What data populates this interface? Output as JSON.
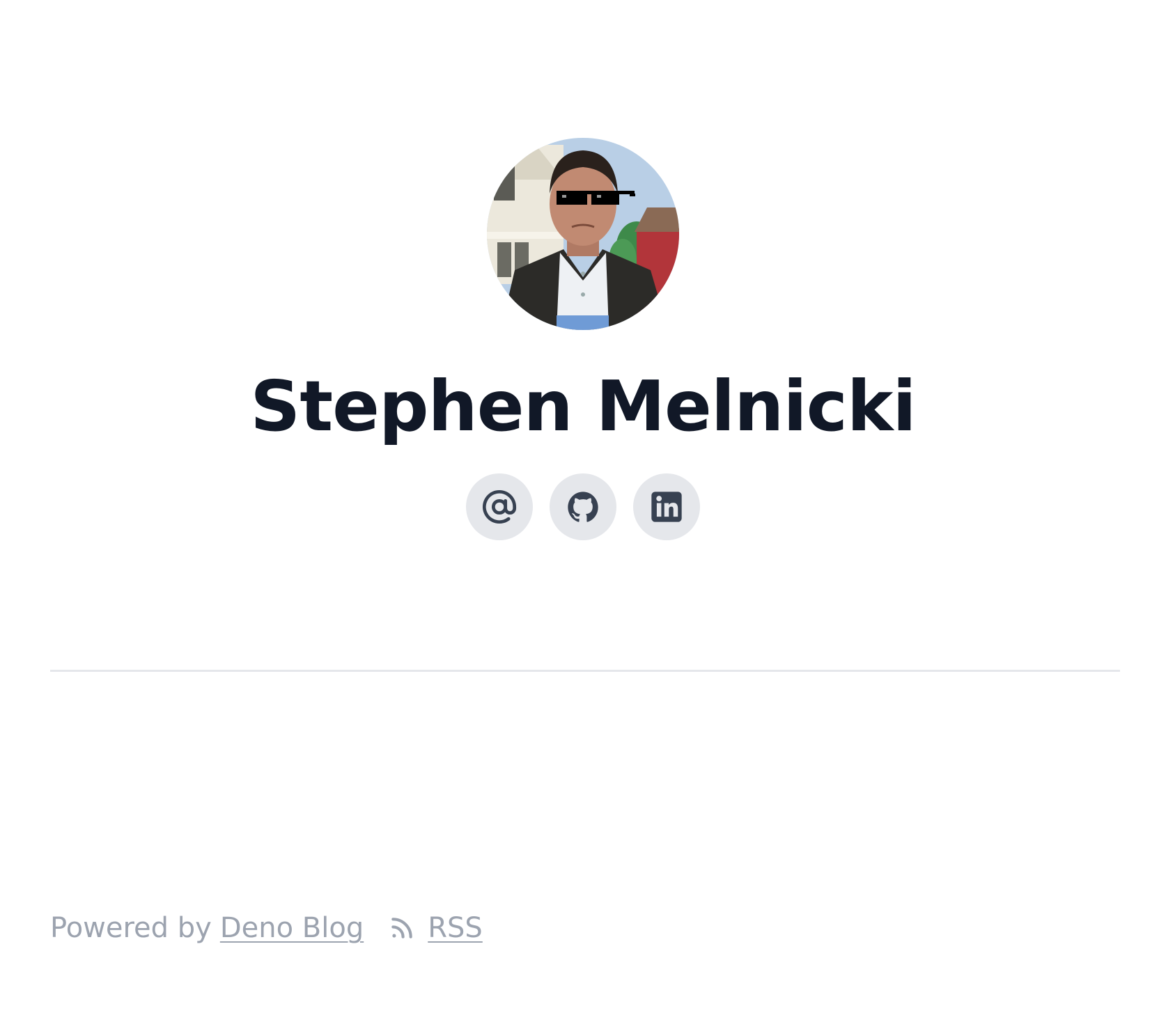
{
  "profile": {
    "name": "Stephen Melnicki",
    "avatar_alt": "Stephen Melnicki avatar"
  },
  "social": {
    "links": [
      {
        "label": "Email",
        "icon": "at-sign-icon"
      },
      {
        "label": "GitHub",
        "icon": "github-icon"
      },
      {
        "label": "LinkedIn",
        "icon": "linkedin-icon"
      }
    ]
  },
  "footer": {
    "powered_by": "Powered by",
    "deno_blog": "Deno Blog",
    "rss": "RSS"
  },
  "colors": {
    "title": "#111827",
    "icon_bg": "#e5e7eb",
    "icon_fg": "#374151",
    "footer_text": "#9ca3af",
    "divider": "#e5e7eb"
  }
}
